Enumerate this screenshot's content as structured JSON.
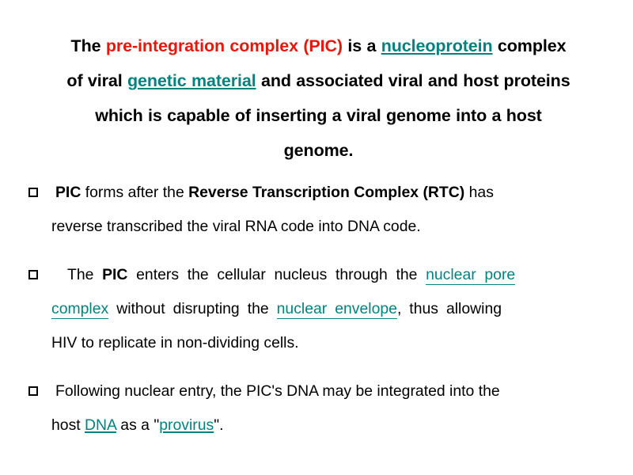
{
  "slide": {
    "background_color": "#ffffff",
    "text_color": "#000000",
    "accent_red": "#e8170c",
    "link_teal": "#00827f"
  },
  "heading": {
    "run1": "The ",
    "run2_red": "pre-integration complex (PIC)",
    "run3": " is a ",
    "run4_link": "nucleoprotein",
    "run5": " complex of viral ",
    "run6_link": "genetic material",
    "run7": " and associated viral and host proteins which is capable of inserting a viral genome into a host genome."
  },
  "bullets": [
    {
      "marker": "hollow-square",
      "runs": [
        {
          "text": "PIC",
          "style": "bold"
        },
        {
          "text": " forms after the ",
          "style": "plain"
        },
        {
          "text": "Reverse Transcription Complex (RTC)",
          "style": "bold"
        },
        {
          "text": " has reverse transcribed the viral RNA code into DNA code.",
          "style": "plain"
        }
      ]
    },
    {
      "marker": "hollow-square",
      "runs": [
        {
          "text": " The ",
          "style": "plain"
        },
        {
          "text": "PIC",
          "style": "bold"
        },
        {
          "text": " enters the cellular nucleus through the ",
          "style": "plain"
        },
        {
          "text": "nuclear pore complex",
          "style": "link"
        },
        {
          "text": " without disrupting the ",
          "style": "plain"
        },
        {
          "text": "nuclear envelope",
          "style": "link"
        },
        {
          "text": ", thus allowing HIV to replicate in non-dividing cells.",
          "style": "plain"
        }
      ]
    },
    {
      "marker": "hollow-square",
      "runs": [
        {
          "text": "Following nuclear entry, the PIC's DNA may be integrated into the host ",
          "style": "plain"
        },
        {
          "text": "DNA",
          "style": "link"
        },
        {
          "text": " as a \"",
          "style": "plain"
        },
        {
          "text": "provirus",
          "style": "link"
        },
        {
          "text": "\".",
          "style": "plain"
        }
      ]
    }
  ],
  "lines": {
    "heading_l1": "The pre-integration complex (PIC) is a nucleoprotein complex",
    "heading_l2": "of viral genetic material and associated viral and host proteins",
    "heading_l3": "which is capable of inserting a viral genome into a host",
    "heading_l4": "genome.",
    "b1_l1": "PIC forms after the Reverse Transcription Complex (RTC) has",
    "b1_l2": "reverse transcribed the viral RNA code into DNA code.",
    "b2_l1": " The PIC enters the cellular nucleus through the nuclear pore",
    "b2_l2": "complex without disrupting the nuclear envelope, thus allowing",
    "b2_l3": "HIV to replicate in non-dividing cells.",
    "b3_l1": "Following nuclear entry, the PIC's DNA may be integrated into the",
    "b3_l2": "host DNA as a \"provirus\"."
  },
  "fragments": {
    "the": "The ",
    "pre_integration": "pre-integration complex (PIC)",
    "is_a": " is a ",
    "nucleoprotein": "nucleoprotein",
    "complex_w": " complex",
    "of_viral": "of viral ",
    "genetic_material": "genetic material",
    "and_assoc": " and associated viral and host proteins",
    "which_is": "which is capable of inserting a viral genome into a host",
    "genome": "genome.",
    "pic": "PIC",
    "forms_after": " forms after the ",
    "rtc": "Reverse Transcription Complex (RTC)",
    "has": " has",
    "reverse_transcribed": "reverse transcribed the viral RNA code into DNA code.",
    "the_sp": "The ",
    "pic2": "PIC",
    "enters": " enters the cellular nucleus through the ",
    "nuclear_pore": "nuclear pore",
    "complex_link": "complex",
    "without_disrupting": " without disrupting the ",
    "nuclear_envelope": "nuclear envelope",
    "comma_thus": ", thus allowing",
    "hiv_replicate": "HIV to replicate in non-dividing cells.",
    "following": "Following nuclear entry, the PIC's DNA may be integrated into the",
    "host": "host ",
    "dna": "DNA",
    "as_a_quote": " as a \"",
    "provirus": "provirus",
    "quote_period": "\"."
  }
}
